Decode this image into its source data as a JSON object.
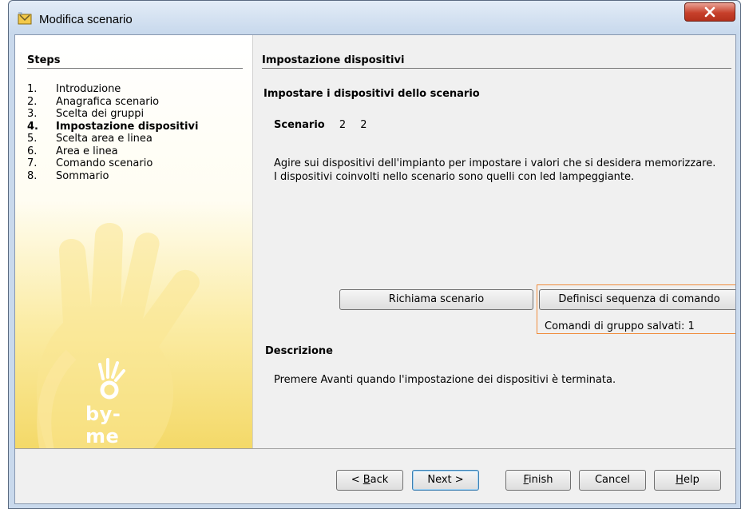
{
  "window": {
    "title": "Modifica scenario",
    "app_icon": "wizard-icon",
    "close_icon": "close-icon"
  },
  "steps": {
    "title": "Steps",
    "items": [
      {
        "num": "1.",
        "label": "Introduzione",
        "current": false
      },
      {
        "num": "2.",
        "label": "Anagrafica scenario",
        "current": false
      },
      {
        "num": "3.",
        "label": "Scelta dei gruppi",
        "current": false
      },
      {
        "num": "4.",
        "label": "Impostazione dispositivi",
        "current": true
      },
      {
        "num": "5.",
        "label": "Scelta area e linea",
        "current": false
      },
      {
        "num": "6.",
        "label": "Area e linea",
        "current": false
      },
      {
        "num": "7.",
        "label": "Comando scenario",
        "current": false
      },
      {
        "num": "8.",
        "label": "Sommario",
        "current": false
      }
    ],
    "logo_text": "by-me"
  },
  "main": {
    "title": "Impostazione dispositivi",
    "subtitle": "Impostare i dispositivi dello scenario",
    "scenario_label": "Scenario",
    "scenario_value_1": "2",
    "scenario_value_2": "2",
    "instructions_line1": "Agire sui dispositivi dell'impianto per impostare i valori che si desidera memorizzare.",
    "instructions_line2": "I dispositivi coinvolti nello scenario sono quelli con led lampeggiante.",
    "recall_button": "Richiama scenario",
    "define_button": "Definisci sequenza di comando",
    "saved_commands": "Comandi di gruppo salvati: 1",
    "description_title": "Descrizione",
    "description_text": "Premere Avanti quando l'impostazione dei dispositivi è terminata."
  },
  "footer": {
    "back": {
      "pre": "< ",
      "mnemonic": "B",
      "post": "ack"
    },
    "next": "Next >",
    "finish": {
      "pre": "",
      "mnemonic": "F",
      "post": "inish"
    },
    "cancel": "Cancel",
    "help": {
      "pre": "",
      "mnemonic": "H",
      "post": "elp"
    }
  },
  "colors": {
    "accent_box": "#f08c3c",
    "titlebar": "#c7d8ec",
    "close_button": "#c7402b",
    "steps_gradient_end": "#f4d968"
  }
}
